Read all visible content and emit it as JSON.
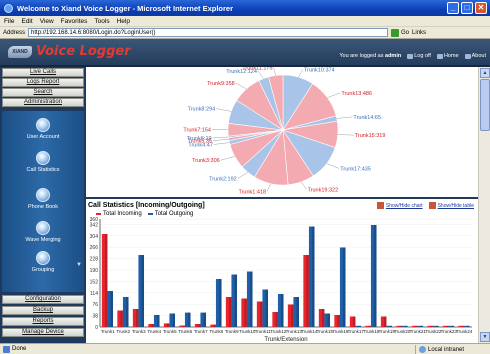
{
  "window": {
    "title": "Welcome to Xiand Voice Logger - Microsoft Internet Explorer",
    "minimize_glyph": "_",
    "maximize_glyph": "□",
    "close_glyph": "✕"
  },
  "menu": {
    "items": [
      "File",
      "Edit",
      "View",
      "Favorites",
      "Tools",
      "Help"
    ]
  },
  "address": {
    "label": "Address",
    "url": "http://192.168.14.6:8080/Login.do?LoginUser()",
    "go_label": "Go",
    "links_label": "Links"
  },
  "app": {
    "brand_mark": "XIAND",
    "brand_name": "Voice Logger",
    "logged_prefix": "You are logged as",
    "user": "admin",
    "logoff": "Log off",
    "home": "Home",
    "about": "About"
  },
  "sidebar": {
    "top_buttons": [
      "Live Calls",
      "Logs Report",
      "Search",
      "Administration"
    ],
    "icon_items": [
      "User Account",
      "Call Statistics",
      "Phone Book",
      "Wave Merging",
      "Grouping"
    ],
    "scroll_glyph": "▼",
    "bottom_buttons": [
      "Configuration",
      "Backup",
      "Reports",
      "Manage Device"
    ]
  },
  "pie": {
    "slices": [
      {
        "label": "Trunk10:374",
        "side": "left",
        "color": "#a8c4e8"
      },
      {
        "label": "Trunk13:486",
        "side": "right",
        "color": "#f3aab0"
      },
      {
        "label": "Trunk14:65",
        "side": "right",
        "color": "#a8c4e8"
      },
      {
        "label": "Trunk15:319",
        "side": "right",
        "color": "#f3aab0"
      },
      {
        "label": "Trunk17:435",
        "side": "right",
        "color": "#a8c4e8"
      },
      {
        "label": "Trunk19:322",
        "side": "right",
        "color": "#f3aab0"
      },
      {
        "label": "Trunk1:418",
        "side": "right",
        "color": "#f3aab0"
      },
      {
        "label": "Trunk2:192",
        "side": "right",
        "color": "#a8c4e8"
      },
      {
        "label": "Trunk3:306",
        "side": "left",
        "color": "#f3aab0"
      },
      {
        "label": "Trunk4:47",
        "side": "left",
        "color": "#a8c4e8"
      },
      {
        "label": "Trunk5:35",
        "side": "left",
        "color": "#f3aab0"
      },
      {
        "label": "Trunk6:19",
        "side": "left",
        "color": "#a8c4e8"
      },
      {
        "label": "Trunk7:154",
        "side": "left",
        "color": "#f3aab0"
      },
      {
        "label": "Trunk8:294",
        "side": "left",
        "color": "#a8c4e8"
      },
      {
        "label": "Trunk9:358",
        "side": "left",
        "color": "#f3aab0"
      },
      {
        "label": "Trunk12:124",
        "side": "left",
        "color": "#a8c4e8"
      },
      {
        "label": "Trunk11:175",
        "side": "left",
        "color": "#f3aab0"
      }
    ]
  },
  "stats": {
    "title": "Call Statistics [Incoming/Outgoing]",
    "show_chart": "Show/Hide chart",
    "show_table": "Show/Hide table",
    "legend_incoming": "Total Incoming",
    "legend_outgoing": "Total Outgoing",
    "incoming_color": "#e8242c",
    "outgoing_color": "#1f5fa8"
  },
  "chart_data": {
    "type": "bar",
    "ylabel": "",
    "xlabel": "Trunk/Extension",
    "ylim": [
      0,
      360
    ],
    "yticks": [
      0,
      38,
      76,
      114,
      152,
      190,
      228,
      266,
      304,
      342,
      360
    ],
    "categories": [
      "Trunk1",
      "Trunk2",
      "Trunk3",
      "Trunk4",
      "Trunk5",
      "Trunk6",
      "Trunk7",
      "Trunk8",
      "Trunk9",
      "Trunk10",
      "Trunk11",
      "Trunk12",
      "Trunk13",
      "Trunk14",
      "Trunk15",
      "Trunk16",
      "Trunk17",
      "Trunk18",
      "Trunk19",
      "Trunk20",
      "Trunk21",
      "Trunk22",
      "Trunk23",
      "Trunk24"
    ],
    "series": [
      {
        "name": "Total Incoming",
        "values": [
          310,
          55,
          60,
          10,
          12,
          5,
          10,
          8,
          100,
          95,
          85,
          50,
          75,
          240,
          60,
          40,
          35,
          0,
          35,
          0,
          0,
          0,
          0,
          0
        ]
      },
      {
        "name": "Total Outgoing",
        "values": [
          120,
          100,
          240,
          40,
          45,
          48,
          48,
          160,
          175,
          185,
          125,
          110,
          100,
          335,
          45,
          265,
          0,
          340,
          0,
          0,
          0,
          0,
          0,
          0
        ]
      }
    ]
  },
  "status": {
    "done": "Done",
    "zone": "Local intranet"
  }
}
